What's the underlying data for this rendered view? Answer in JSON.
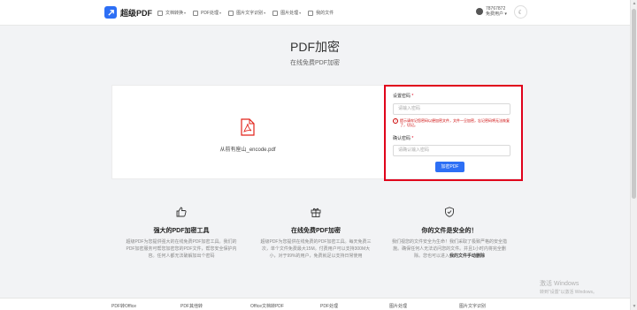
{
  "header": {
    "brand": "超级PDF",
    "nav": [
      {
        "label": "文档转换",
        "dropdown": true
      },
      {
        "label": "PDF处理",
        "dropdown": true
      },
      {
        "label": "图片文字识别",
        "dropdown": true
      },
      {
        "label": "图片处理",
        "dropdown": true
      },
      {
        "label": "我的文件",
        "dropdown": false
      }
    ],
    "user": {
      "id": "78767872",
      "plan": "免费用户"
    }
  },
  "hero": {
    "title": "PDF加密",
    "subtitle": "在线免费PDF加密"
  },
  "panel": {
    "file_name": "从前有座山_encode.pdf",
    "set_password_label": "设置密码",
    "set_password_placeholder": "请输入密码",
    "warning": "提示请牢记您密码以便加密文件，文件一旦加密，忘记密码将无法恢复了，切记。",
    "confirm_password_label": "确认密码",
    "confirm_password_placeholder": "请确认输入密码",
    "button_label": "加密PDF"
  },
  "features": [
    {
      "icon": "thumbs-up-icon",
      "title": "强大的PDF加密工具",
      "desc": "超级PDF为您提供强大的在线免费PDF加密工具。我们的PDF加密服务可帮您加密您的PDF文件，帮您安全保护内容。任何人都无法破解加出个密码"
    },
    {
      "icon": "gift-icon",
      "title": "在线免费PDF加密",
      "desc": "超级PDF为您提供在线免费的PDF加密工具。每天免费三次，单个文件免费最大15M。付费用户可以支持300M大小，对于99%的用户，免费就足以支持日常使用"
    },
    {
      "icon": "shield-check-icon",
      "title": "你的文件是安全的！",
      "desc": "我们视您的文件安全为生命！我们采取了极致严格的安全措施。确保任何人无法访问您的文件。并且1小时内将完全删除。您也可以进入",
      "desc_bold": "我的文件手动删除"
    }
  ],
  "watermark": {
    "line1": "激活 Windows",
    "line2": "转到“设置”以激活 Windows。"
  },
  "footer": [
    "PDF转Office",
    "PDF其他转",
    "Office文档转PDF",
    "PDF处理",
    "图片处理",
    "图片文字识别"
  ],
  "colors": {
    "accent": "#2d6ff5",
    "highlight_border": "#e0001b"
  }
}
